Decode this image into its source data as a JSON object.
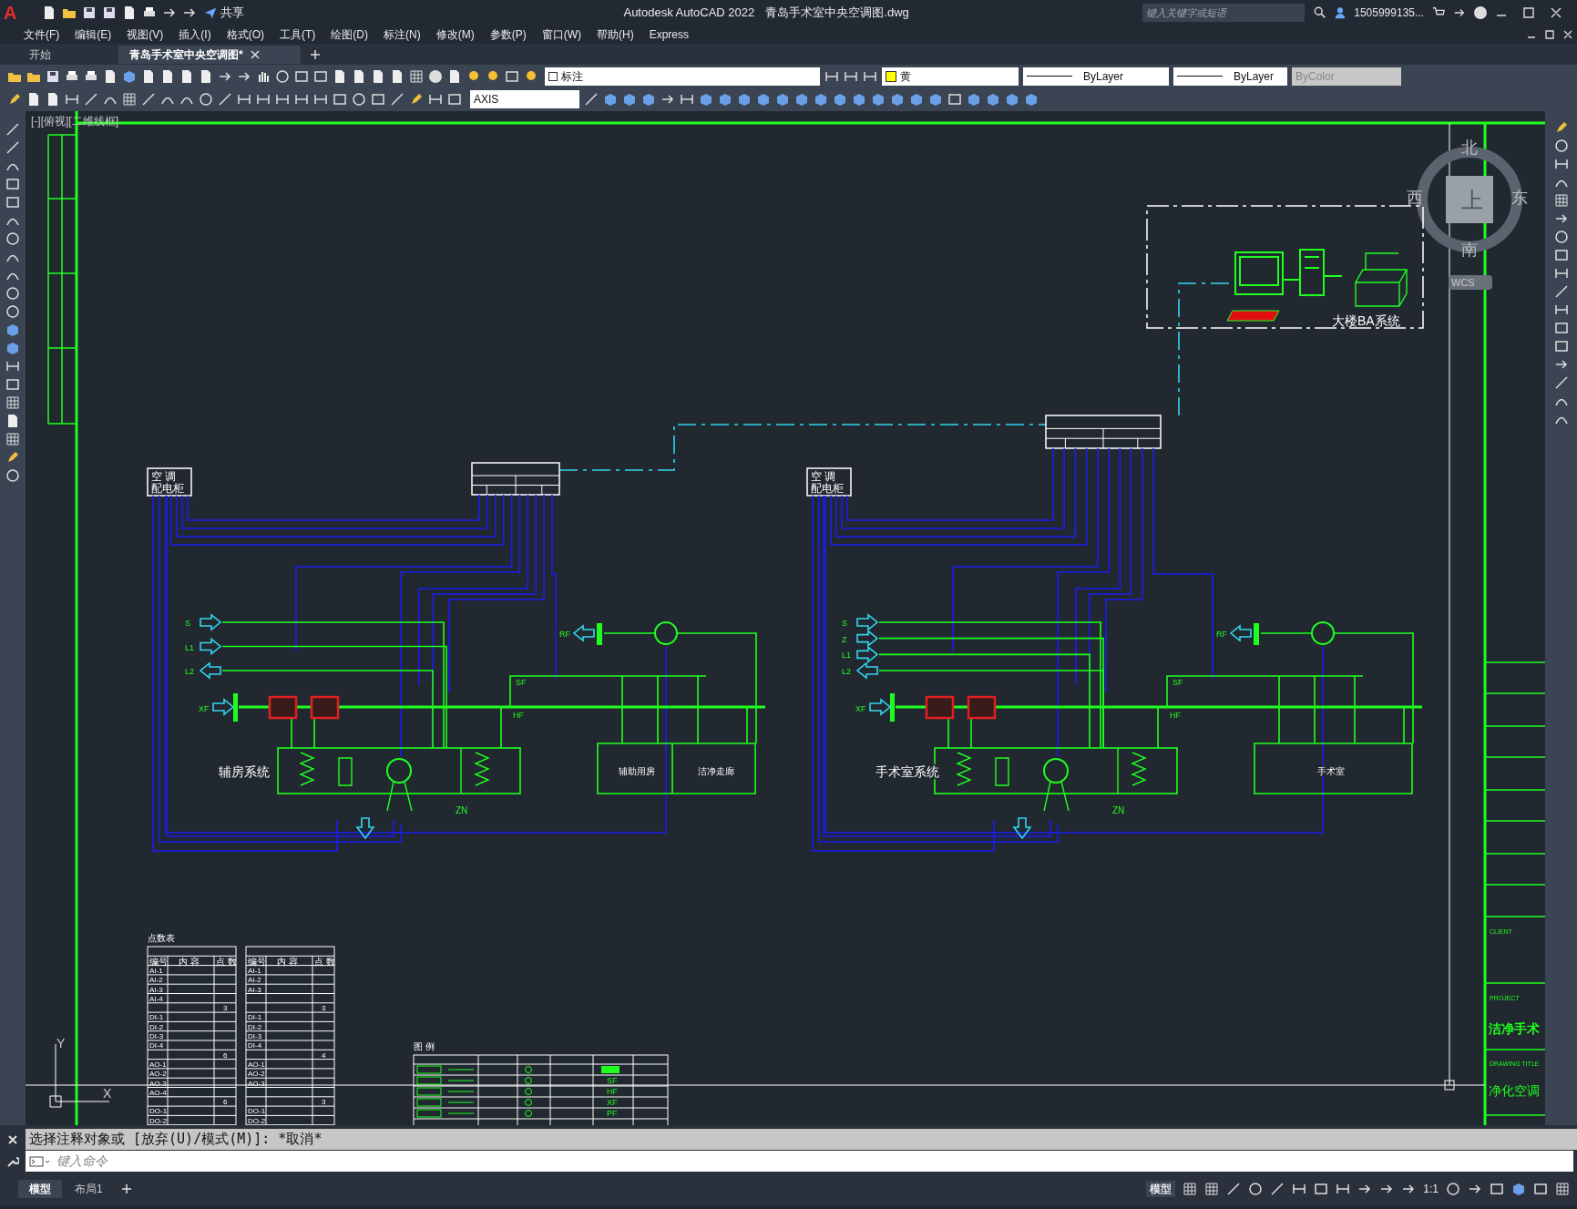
{
  "title_bar": {
    "logo": "A",
    "share": "共享",
    "app": "Autodesk AutoCAD 2022",
    "file": "青岛手术室中央空调图.dwg",
    "search": {
      "placeholder": "键入关键字或短语"
    },
    "user": "1505999135..."
  },
  "menu": [
    "文件(F)",
    "编辑(E)",
    "视图(V)",
    "插入(I)",
    "格式(O)",
    "工具(T)",
    "绘图(D)",
    "标注(N)",
    "修改(M)",
    "参数(P)",
    "窗口(W)",
    "帮助(H)",
    "Express"
  ],
  "tabs": [
    {
      "label": "开始",
      "selected": false
    },
    {
      "label": "青岛手术室中央空调图*",
      "selected": true
    }
  ],
  "toolbar": {
    "layer": "标注",
    "color": {
      "label": "黄",
      "color": "#ffff00"
    },
    "linetype": "ByLayer",
    "lineweight": "ByLayer",
    "plot_style": "ByColor",
    "dim_style": "AXIS"
  },
  "viewport_label": "[-][俯视][二维线框]",
  "viewcube": {
    "north": "北",
    "south": "南",
    "west": "西",
    "east": "东",
    "top": "上",
    "ucs": "WCS"
  },
  "drawing": {
    "systems": [
      {
        "name": "辅房系统",
        "cabinet": [
          "空 调",
          "配电柜"
        ],
        "inlets": [
          {
            "label": "S",
            "kind": "inlet"
          },
          {
            "label": "L1",
            "kind": "inlet"
          },
          {
            "label": "L2",
            "kind": "outlet"
          }
        ],
        "fresh_air": "XF",
        "return_air": "RF",
        "supply_air": "SF",
        "return_duct": "HF",
        "zn": "ZN",
        "rooms": [
          "辅助用房",
          "洁净走廊"
        ]
      },
      {
        "name": "手术室系统",
        "cabinet": [
          "空 调",
          "配电柜"
        ],
        "inlets": [
          {
            "label": "S",
            "kind": "inlet"
          },
          {
            "label": "Z",
            "kind": "inlet"
          },
          {
            "label": "L1",
            "kind": "inlet"
          },
          {
            "label": "L2",
            "kind": "outlet"
          }
        ],
        "fresh_air": "XF",
        "return_air": "RF",
        "supply_air": "SF",
        "return_duct": "HF",
        "zn": "ZN",
        "rooms": [
          "手术室"
        ]
      }
    ],
    "ba_system": "大楼BA系统",
    "point_table_title": "点数表",
    "point_tables": [
      {
        "header": [
          "编号",
          "内 容",
          "点 数"
        ],
        "rows": [
          [
            "AI-1",
            ""
          ],
          [
            "AI-2",
            ""
          ],
          [
            "AI-3",
            ""
          ],
          [
            "AI-4",
            ""
          ],
          [
            "",
            "3"
          ],
          [
            "DI-1",
            ""
          ],
          [
            "DI-2",
            ""
          ],
          [
            "DI-3",
            ""
          ],
          [
            "DI-4",
            ""
          ],
          [
            "",
            "6"
          ],
          [
            "AO-1",
            ""
          ],
          [
            "AO-2",
            ""
          ],
          [
            "AO-3",
            ""
          ],
          [
            "AO-4",
            ""
          ],
          [
            "",
            "6"
          ],
          [
            "DO-1",
            ""
          ],
          [
            "DO-2",
            ""
          ]
        ]
      },
      {
        "header": [
          "编号",
          "内 容",
          "点 数"
        ],
        "rows": [
          [
            "AI-1",
            ""
          ],
          [
            "AI-2",
            ""
          ],
          [
            "AI-3",
            ""
          ],
          [
            "",
            ""
          ],
          [
            "",
            "3"
          ],
          [
            "DI-1",
            ""
          ],
          [
            "DI-2",
            ""
          ],
          [
            "DI-3",
            ""
          ],
          [
            "DI-4",
            ""
          ],
          [
            "",
            "4"
          ],
          [
            "AO-1",
            ""
          ],
          [
            "AO-2",
            ""
          ],
          [
            "AO-3",
            ""
          ],
          [
            "",
            ""
          ],
          [
            "",
            "3"
          ],
          [
            "DO-1",
            ""
          ],
          [
            "DO-2",
            ""
          ]
        ]
      }
    ],
    "legend_title": "图 例",
    "legend_codes": [
      "SF",
      "HF",
      "XF",
      "PF"
    ],
    "title_block": {
      "client": "CLIENT",
      "project": "PROJECT",
      "project_name": "洁净手术",
      "drawing_title": "DRAWING TITLE",
      "title_name": "净化空调"
    },
    "ucs": {
      "x": "X",
      "y": "Y"
    }
  },
  "command": {
    "history": "选择注释对象或 [放弃(U)/模式(M)]: *取消*",
    "placeholder": "键入命令"
  },
  "layout_tabs": [
    {
      "label": "模型",
      "selected": true
    },
    {
      "label": "布局1",
      "selected": false
    }
  ],
  "status_bar": {
    "space": "模型",
    "scale": "1:1"
  }
}
